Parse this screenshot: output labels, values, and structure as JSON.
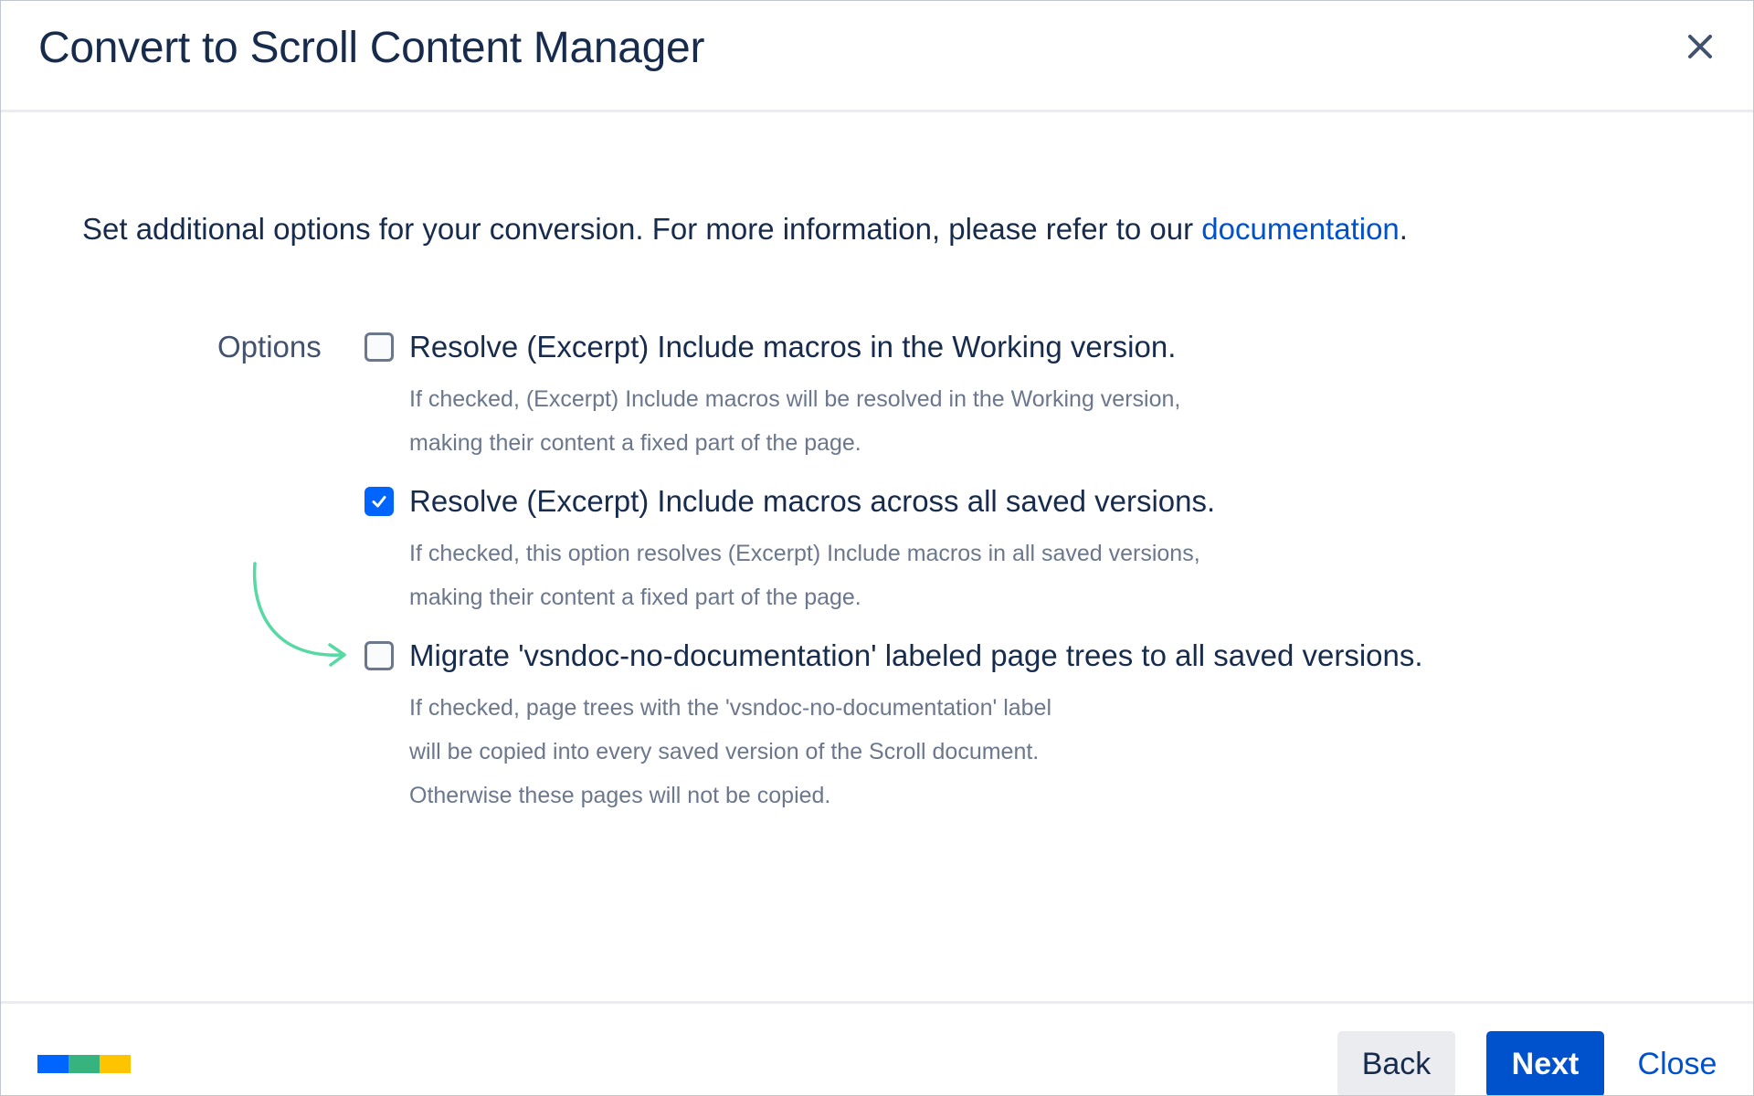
{
  "dialog": {
    "title": "Convert to Scroll Content Manager",
    "close_icon": "close-icon"
  },
  "intro": {
    "text": "Set additional options for your conversion. For more information, please refer to our ",
    "link": "documentation",
    "trailing": "."
  },
  "options": {
    "label": "Options",
    "items": [
      {
        "label": "Resolve (Excerpt) Include macros in the Working version.",
        "checked": false,
        "description": [
          "If checked, (Excerpt) Include macros will be resolved in the Working version,",
          "making their content a fixed part of the page."
        ]
      },
      {
        "label": "Resolve (Excerpt) Include macros across all saved versions.",
        "checked": true,
        "description": [
          "If checked, this option resolves (Excerpt) Include macros in all saved versions,",
          "making their content a fixed part of the page."
        ]
      },
      {
        "label": "Migrate 'vsndoc-no-documentation' labeled page trees to all saved versions.",
        "checked": false,
        "description": [
          "If checked, page trees with the 'vsndoc-no-documentation' label",
          "will be copied into every saved version of the Scroll document.",
          "Otherwise these pages will not be copied."
        ]
      }
    ]
  },
  "annotation": {
    "arrow_icon": "curved-arrow-icon",
    "color": "#57d9a3"
  },
  "footer": {
    "logo_colors": [
      "#0065ff",
      "#36b37e",
      "#ffc400"
    ],
    "back_label": "Back",
    "next_label": "Next",
    "close_label": "Close"
  },
  "colors": {
    "primary": "#0052cc",
    "checkbox_checked": "#0065ff",
    "text": "#172b4d",
    "subtle_text": "#6b778c"
  }
}
